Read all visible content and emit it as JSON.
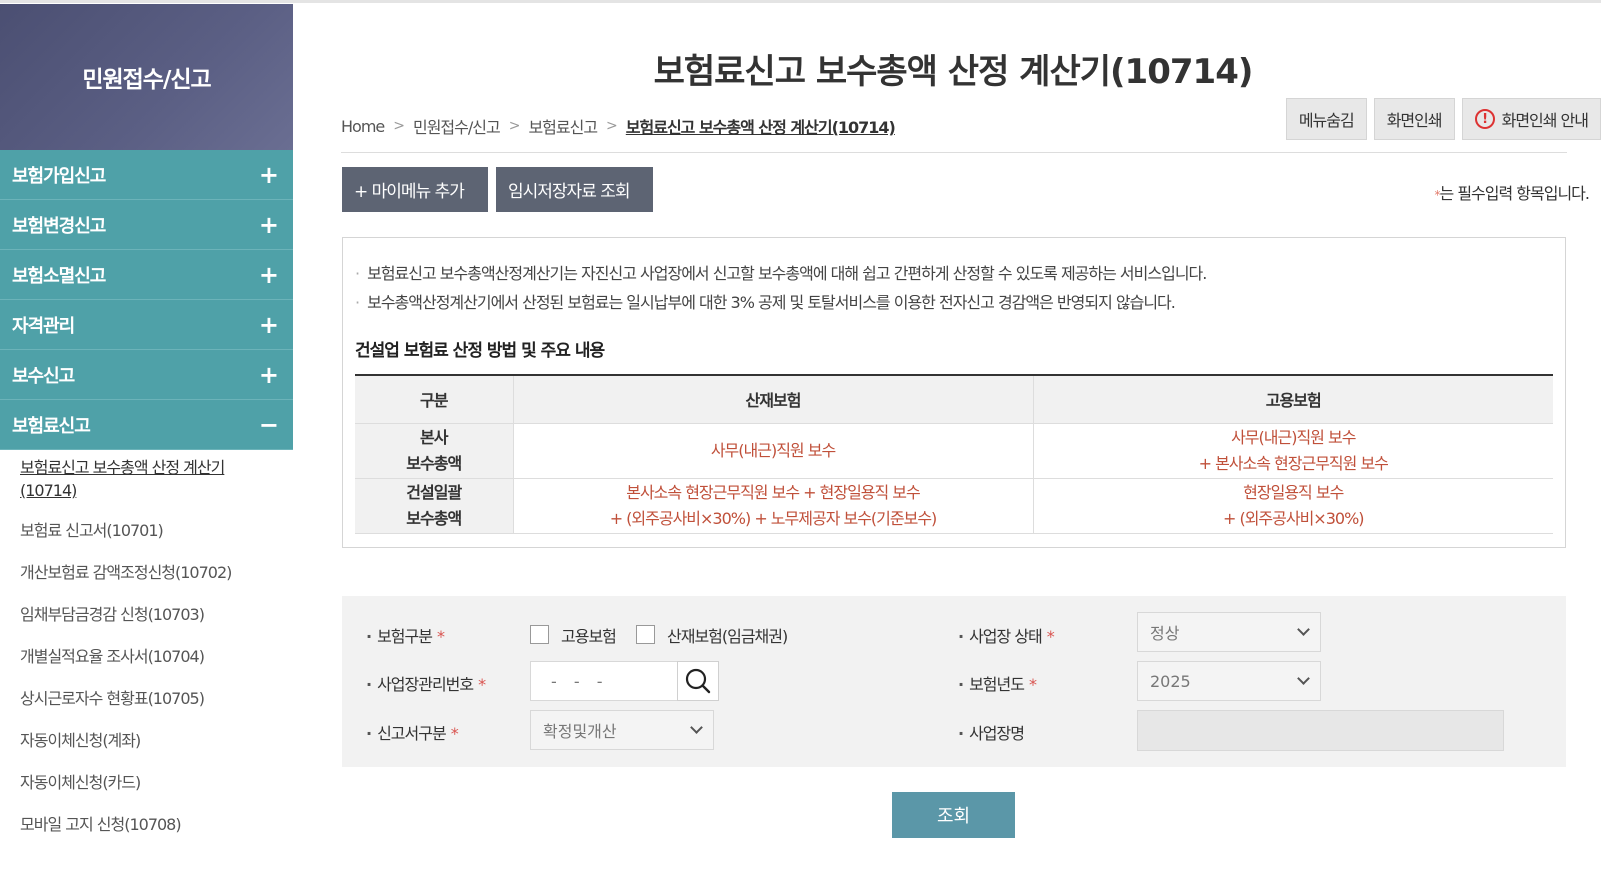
{
  "sidebar": {
    "title": "민원접수/신고",
    "menu": [
      {
        "label": "보험가입신고",
        "toggle": "+"
      },
      {
        "label": "보험변경신고",
        "toggle": "+"
      },
      {
        "label": "보험소멸신고",
        "toggle": "+"
      },
      {
        "label": "자격관리",
        "toggle": "+"
      },
      {
        "label": "보수신고",
        "toggle": "+"
      },
      {
        "label": "보험료신고",
        "toggle": "−"
      }
    ],
    "submenu": [
      "보험료신고 보수총액 산정 계산기",
      "(10714)",
      "보험료 신고서(10701)",
      "개산보험료 감액조정신청(10702)",
      "임채부담금경감 신청(10703)",
      "개별실적요율 조사서(10704)",
      "상시근로자수 현황표(10705)",
      "자동이체신청(계좌)",
      "자동이체신청(카드)",
      "모바일 고지 신청(10708)"
    ]
  },
  "page": {
    "title": "보험료신고 보수총액 산정 계산기(10714)",
    "breadcrumb": [
      "Home",
      "민원접수/신고",
      "보험료신고",
      "보험료신고 보수총액 산정 계산기(10714)"
    ],
    "breadcrumb_sep": ">",
    "buttons": {
      "hide_menu": "메뉴숨김",
      "print": "화면인쇄",
      "print_guide": "화면인쇄 안내",
      "warn_glyph": "!"
    },
    "add_mymenu": "+ 마이메뉴 추가",
    "temp_saved": "임시저장자료 조회",
    "required_note_star": "*",
    "required_note": "는 필수입력 항목입니다."
  },
  "info": {
    "bullets": [
      "보험료신고 보수총액산정계산기는 자진신고 사업장에서 신고할 보수총액에 대해 쉽고 간편하게 산정할 수 있도록 제공하는 서비스입니다.",
      "보수총액산정계산기에서 산정된 보험료는 일시납부에 대한 3% 공제 및 토탈서비스를 이용한 전자신고 경감액은 반영되지 않습니다."
    ],
    "subhead": "건설업 보험료 산정 방법 및 주요 내용",
    "table": {
      "headers": [
        "구분",
        "산재보험",
        "고용보험"
      ],
      "rows": [
        {
          "label1": "본사",
          "label2": "보수총액",
          "c1_1": "사무(내근)직원 보수",
          "c1_2": "",
          "c2_1": "사무(내근)직원 보수",
          "c2_2": "+ 본사소속 현장근무직원 보수"
        },
        {
          "label1": "건설일괄",
          "label2": "보수총액",
          "c1_1": "본사소속 현장근무직원 보수 + 현장일용직 보수",
          "c1_2": "+ (외주공사비×30%) + 노무제공자 보수(기준보수)",
          "c2_1": "현장일용직 보수",
          "c2_2": "+ (외주공사비×30%)"
        }
      ]
    }
  },
  "form": {
    "insurance_type_label": "보험구분",
    "req_star": "*",
    "chk_employment": "고용보험",
    "chk_industrial": "산재보험(임금채권)",
    "biz_status_label": "사업장 상태",
    "biz_status_value": "정상",
    "biz_no_label": "사업장관리번호",
    "biz_no_value": "- -   -",
    "year_label": "보험년도",
    "year_value": "2025",
    "report_type_label": "신고서구분",
    "report_type_value": "확정및개산",
    "biz_name_label": "사업장명",
    "biz_name_value": "",
    "search_button": "조회"
  }
}
